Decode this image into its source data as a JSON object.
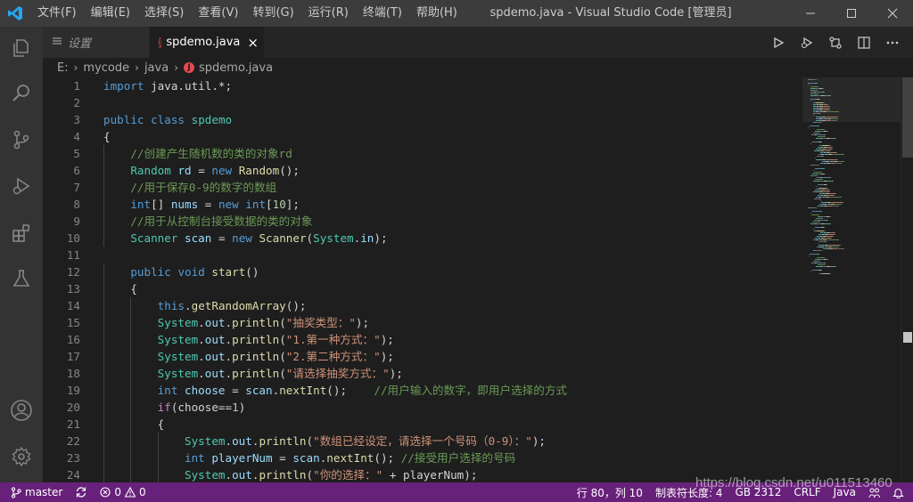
{
  "titlebar": {
    "menu": [
      "文件(F)",
      "编辑(E)",
      "选择(S)",
      "查看(V)",
      "转到(G)",
      "运行(R)",
      "终端(T)",
      "帮助(H)"
    ],
    "window_title": "spdemo.java - Visual Studio Code [管理员]",
    "accent": "#0078d4"
  },
  "activity_icons": [
    "explorer-icon",
    "search-icon",
    "source-control-icon",
    "run-debug-icon",
    "extensions-icon",
    "testing-icon",
    "account-icon",
    "settings-gear-icon"
  ],
  "tabs": [
    {
      "label": "设置",
      "icon": "settings-file-icon"
    },
    {
      "label": "spdemo.java",
      "icon": "java-file-icon",
      "close": "×"
    }
  ],
  "breadcrumb": [
    "E:",
    "mycode",
    "java",
    "spdemo.java"
  ],
  "java_badge": "J",
  "editor": {
    "lines": [
      {
        "n": "1",
        "indent": 0,
        "tokens": [
          [
            "kw",
            "import"
          ],
          [
            "plain",
            " java.util.*;"
          ]
        ]
      },
      {
        "n": "2",
        "indent": 0,
        "tokens": []
      },
      {
        "n": "3",
        "indent": 0,
        "tokens": [
          [
            "kw",
            "public"
          ],
          [
            "plain",
            " "
          ],
          [
            "kw",
            "class"
          ],
          [
            "plain",
            " "
          ],
          [
            "cls",
            "spdemo"
          ]
        ]
      },
      {
        "n": "4",
        "indent": 0,
        "tokens": [
          [
            "plain",
            "{"
          ]
        ]
      },
      {
        "n": "5",
        "indent": 1,
        "tokens": [
          [
            "cmt",
            "//创建产生随机数的类的对象rd"
          ]
        ]
      },
      {
        "n": "6",
        "indent": 1,
        "tokens": [
          [
            "cls",
            "Random"
          ],
          [
            "plain",
            " "
          ],
          [
            "var",
            "rd"
          ],
          [
            "plain",
            " = "
          ],
          [
            "kw",
            "new"
          ],
          [
            "plain",
            " "
          ],
          [
            "fn",
            "Random"
          ],
          [
            "plain",
            "();"
          ]
        ]
      },
      {
        "n": "7",
        "indent": 1,
        "tokens": [
          [
            "cmt",
            "//用于保存0-9的数字的数组"
          ]
        ]
      },
      {
        "n": "8",
        "indent": 1,
        "tokens": [
          [
            "kw",
            "int"
          ],
          [
            "plain",
            "[] "
          ],
          [
            "var",
            "nums"
          ],
          [
            "plain",
            " = "
          ],
          [
            "kw",
            "new"
          ],
          [
            "plain",
            " "
          ],
          [
            "kw",
            "int"
          ],
          [
            "plain",
            "["
          ],
          [
            "num",
            "10"
          ],
          [
            "plain",
            "];"
          ]
        ]
      },
      {
        "n": "9",
        "indent": 1,
        "tokens": [
          [
            "cmt",
            "//用于从控制台接受数据的类的对象"
          ]
        ]
      },
      {
        "n": "10",
        "indent": 1,
        "tokens": [
          [
            "cls",
            "Scanner"
          ],
          [
            "plain",
            " "
          ],
          [
            "var",
            "scan"
          ],
          [
            "plain",
            " = "
          ],
          [
            "kw",
            "new"
          ],
          [
            "plain",
            " "
          ],
          [
            "fn",
            "Scanner"
          ],
          [
            "plain",
            "("
          ],
          [
            "cls",
            "System"
          ],
          [
            "plain",
            "."
          ],
          [
            "var",
            "in"
          ],
          [
            "plain",
            ");"
          ]
        ]
      },
      {
        "n": "11",
        "indent": 0,
        "tokens": []
      },
      {
        "n": "12",
        "indent": 1,
        "tokens": [
          [
            "kw",
            "public"
          ],
          [
            "plain",
            " "
          ],
          [
            "kw",
            "void"
          ],
          [
            "plain",
            " "
          ],
          [
            "fn",
            "start"
          ],
          [
            "plain",
            "()"
          ]
        ]
      },
      {
        "n": "13",
        "indent": 1,
        "tokens": [
          [
            "plain",
            "{"
          ]
        ]
      },
      {
        "n": "14",
        "indent": 2,
        "tokens": [
          [
            "kw",
            "this"
          ],
          [
            "plain",
            "."
          ],
          [
            "fn",
            "getRandomArray"
          ],
          [
            "plain",
            "();"
          ]
        ]
      },
      {
        "n": "15",
        "indent": 2,
        "tokens": [
          [
            "cls",
            "System"
          ],
          [
            "plain",
            "."
          ],
          [
            "var",
            "out"
          ],
          [
            "plain",
            "."
          ],
          [
            "fn",
            "println"
          ],
          [
            "plain",
            "("
          ],
          [
            "str",
            "\"抽奖类型：\""
          ],
          [
            "plain",
            ");"
          ]
        ]
      },
      {
        "n": "16",
        "indent": 2,
        "tokens": [
          [
            "cls",
            "System"
          ],
          [
            "plain",
            "."
          ],
          [
            "var",
            "out"
          ],
          [
            "plain",
            "."
          ],
          [
            "fn",
            "println"
          ],
          [
            "plain",
            "("
          ],
          [
            "str",
            "\"1.第一种方式：\""
          ],
          [
            "plain",
            ");"
          ]
        ]
      },
      {
        "n": "17",
        "indent": 2,
        "tokens": [
          [
            "cls",
            "System"
          ],
          [
            "plain",
            "."
          ],
          [
            "var",
            "out"
          ],
          [
            "plain",
            "."
          ],
          [
            "fn",
            "println"
          ],
          [
            "plain",
            "("
          ],
          [
            "str",
            "\"2.第二种方式：\""
          ],
          [
            "plain",
            ");"
          ]
        ]
      },
      {
        "n": "18",
        "indent": 2,
        "tokens": [
          [
            "cls",
            "System"
          ],
          [
            "plain",
            "."
          ],
          [
            "var",
            "out"
          ],
          [
            "plain",
            "."
          ],
          [
            "fn",
            "println"
          ],
          [
            "plain",
            "("
          ],
          [
            "str",
            "\"请选择抽奖方式：\""
          ],
          [
            "plain",
            ");"
          ]
        ]
      },
      {
        "n": "19",
        "indent": 2,
        "tokens": [
          [
            "kw",
            "int"
          ],
          [
            "plain",
            " "
          ],
          [
            "var",
            "choose"
          ],
          [
            "plain",
            " = "
          ],
          [
            "var",
            "scan"
          ],
          [
            "plain",
            "."
          ],
          [
            "fn",
            "nextInt"
          ],
          [
            "plain",
            "();    "
          ],
          [
            "cmt",
            "//用户输入的数字，即用户选择的方式"
          ]
        ]
      },
      {
        "n": "20",
        "indent": 2,
        "tokens": [
          [
            "ctl",
            "if"
          ],
          [
            "plain",
            "(choose=="
          ],
          [
            "num",
            "1"
          ],
          [
            "plain",
            ")"
          ]
        ]
      },
      {
        "n": "21",
        "indent": 2,
        "tokens": [
          [
            "plain",
            "{"
          ]
        ]
      },
      {
        "n": "22",
        "indent": 3,
        "tokens": [
          [
            "cls",
            "System"
          ],
          [
            "plain",
            "."
          ],
          [
            "var",
            "out"
          ],
          [
            "plain",
            "."
          ],
          [
            "fn",
            "println"
          ],
          [
            "plain",
            "("
          ],
          [
            "str",
            "\"数组已经设定，请选择一个号码（0-9）：\""
          ],
          [
            "plain",
            ");"
          ]
        ]
      },
      {
        "n": "23",
        "indent": 3,
        "tokens": [
          [
            "kw",
            "int"
          ],
          [
            "plain",
            " "
          ],
          [
            "var",
            "playerNum"
          ],
          [
            "plain",
            " = "
          ],
          [
            "var",
            "scan"
          ],
          [
            "plain",
            "."
          ],
          [
            "fn",
            "nextInt"
          ],
          [
            "plain",
            "(); "
          ],
          [
            "cmt",
            "//接受用户选择的号码"
          ]
        ]
      },
      {
        "n": "24",
        "indent": 3,
        "tokens": [
          [
            "cls",
            "System"
          ],
          [
            "plain",
            "."
          ],
          [
            "var",
            "out"
          ],
          [
            "plain",
            "."
          ],
          [
            "fn",
            "println"
          ],
          [
            "plain",
            "("
          ],
          [
            "str",
            "\"你的选择：\""
          ],
          [
            "plain",
            " + playerNum);"
          ]
        ]
      }
    ]
  },
  "statusbar": {
    "branch": "master",
    "errors": "0",
    "warnings": "0",
    "position": "行 80，列 10",
    "tab_size": "制表符长度: 4",
    "encoding": "GB 2312",
    "eol": "CRLF",
    "language": "Java",
    "background": "#68217a"
  },
  "watermark": "https://blog.csdn.net/u011513460"
}
